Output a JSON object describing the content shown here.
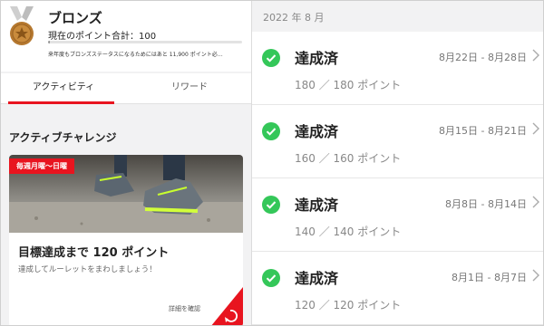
{
  "colors": {
    "accent": "#e8141f",
    "success": "#34c759",
    "bronze": "#b5782f"
  },
  "status": {
    "rank": "ブロンズ",
    "points_label": "現在のポイント合計：100",
    "progress_fraction": 0.01,
    "note": "来年度もブロンズステータスになるためにはあと 11,900 ポイント必…"
  },
  "tabs": [
    {
      "label": "アクティビティ",
      "active": true
    },
    {
      "label": "リワード",
      "active": false
    }
  ],
  "section_title": "アクティブチャレンジ",
  "card": {
    "badge": "毎週月曜〜日曜",
    "title": "目標達成まで 120 ポイント",
    "subtitle": "達成してルーレットをまわしましょう！",
    "link": "詳細を確認",
    "corner_icon": "refresh-icon"
  },
  "history": {
    "month": "2022 年 8 月",
    "items": [
      {
        "status": "達成済",
        "dates": "8月22日 - 8月28日",
        "points": "180 ／ 180 ポイント"
      },
      {
        "status": "達成済",
        "dates": "8月15日 - 8月21日",
        "points": "160 ／ 160 ポイント"
      },
      {
        "status": "達成済",
        "dates": "8月8日 - 8月14日",
        "points": "140 ／ 140 ポイント"
      },
      {
        "status": "達成済",
        "dates": "8月1日 - 8月7日",
        "points": "120 ／ 120 ポイント"
      }
    ]
  }
}
